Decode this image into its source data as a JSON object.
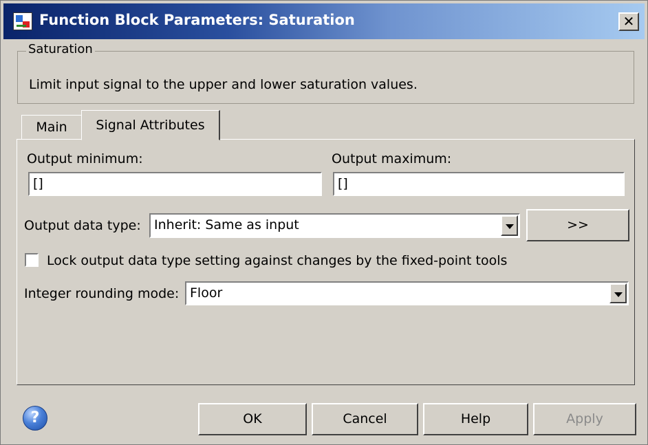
{
  "window": {
    "title": "Function Block Parameters: Saturation",
    "close_label": "✕"
  },
  "description": {
    "group_label": "Saturation",
    "text": "Limit input signal to the upper and lower saturation values."
  },
  "tabs": [
    {
      "label": "Main",
      "selected": false
    },
    {
      "label": "Signal Attributes",
      "selected": true
    }
  ],
  "signal_attributes": {
    "output_minimum_label": "Output minimum:",
    "output_minimum_value": "[]",
    "output_maximum_label": "Output maximum:",
    "output_maximum_value": "[]",
    "output_data_type_label": "Output data type:",
    "output_data_type_value": "Inherit: Same as input",
    "show_assistant_label": ">>",
    "lock_label": "Lock output data type setting against changes by the fixed-point tools",
    "lock_checked": false,
    "rounding_mode_label": "Integer rounding mode:",
    "rounding_mode_value": "Floor"
  },
  "buttons": {
    "ok": "OK",
    "cancel": "Cancel",
    "help": "Help",
    "apply": "Apply"
  },
  "icons": {
    "help": "help-question-icon",
    "app": "simulink-block-icon",
    "close": "close-icon",
    "dropdown": "chevron-down-icon"
  },
  "colors": {
    "dialog_background": "#d4d0c8",
    "title_gradient_start": "#0a246a",
    "title_gradient_end": "#a6caf0",
    "disabled_text": "#8a8a8a"
  }
}
